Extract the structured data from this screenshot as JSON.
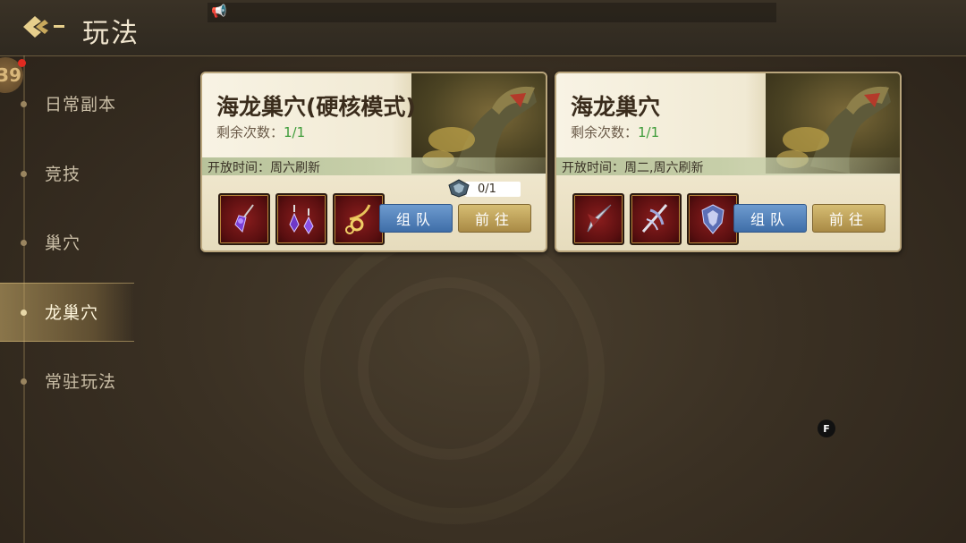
{
  "header": {
    "title": "玩法"
  },
  "player": {
    "level_badge": "39"
  },
  "sidebar": {
    "items": [
      {
        "label": "日常副本"
      },
      {
        "label": "竞技"
      },
      {
        "label": "巢穴"
      },
      {
        "label": "龙巢穴",
        "active": true
      },
      {
        "label": "常驻玩法"
      }
    ]
  },
  "cards": [
    {
      "name": "海龙巢穴(硬核模式)",
      "remain_label": "剩余次数：",
      "remain_value": "1/1",
      "open_time": "开放时间：周六刷新",
      "token_count": "0/1",
      "items": [
        "purple-pendant-icon",
        "purple-earrings-icon",
        "gold-necklace-icon"
      ],
      "team_label": "组队",
      "go_label": "前往"
    },
    {
      "name": "海龙巢穴",
      "remain_label": "剩余次数：",
      "remain_value": "1/1",
      "open_time": "开放时间：周二,周六刷新",
      "items": [
        "blade-icon",
        "claw-weapon-icon",
        "armor-icon"
      ],
      "team_label": "组队",
      "go_label": "前往"
    }
  ],
  "overlay": {
    "f_badge": "F"
  },
  "colors": {
    "accent_gold": "#d6bd73",
    "team_blue": "#3f6ea8",
    "remain_green": "#3e9c3a"
  }
}
